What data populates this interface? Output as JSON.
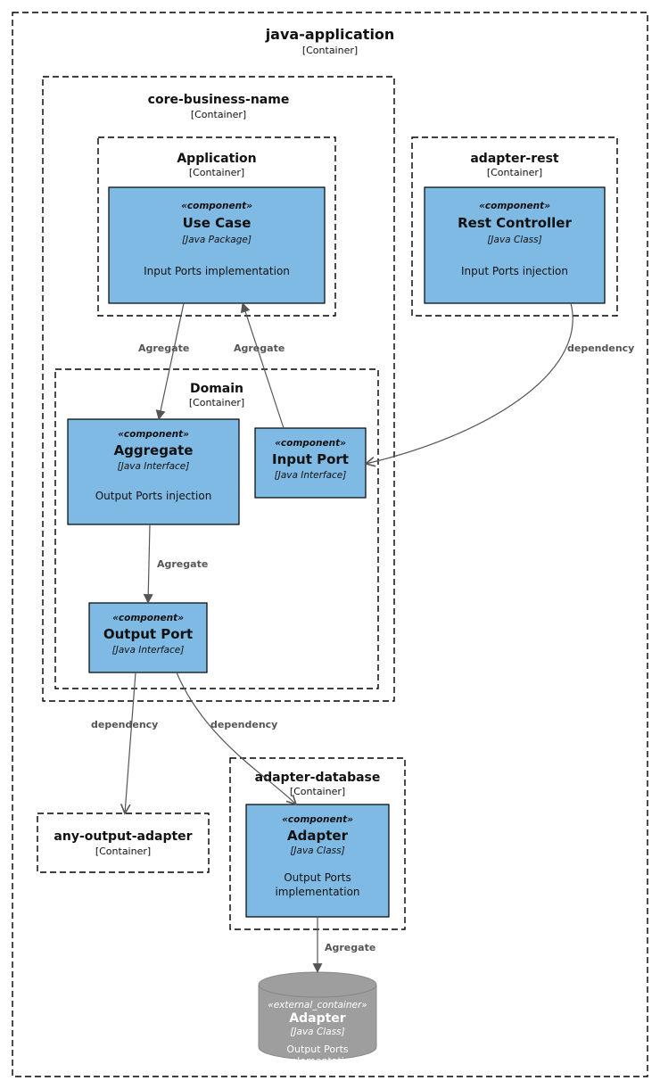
{
  "outer": {
    "title": "java-application",
    "subtype": "[Container]"
  },
  "core": {
    "title": "core-business-name",
    "subtype": "[Container]"
  },
  "application": {
    "title": "Application",
    "subtype": "[Container]"
  },
  "domain": {
    "title": "Domain",
    "subtype": "[Container]"
  },
  "adapter_rest": {
    "title": "adapter-rest",
    "subtype": "[Container]"
  },
  "adapter_db": {
    "title": "adapter-database",
    "subtype": "[Container]"
  },
  "any_output": {
    "title": "any-output-adapter",
    "subtype": "[Container]"
  },
  "usecase": {
    "stereo": "«component»",
    "name": "Use Case",
    "tech": "[Java Package]",
    "desc": "Input Ports implementation"
  },
  "restctrl": {
    "stereo": "«component»",
    "name": "Rest Controller",
    "tech": "[Java Class]",
    "desc": "Input Ports injection"
  },
  "aggregate": {
    "stereo": "«component»",
    "name": "Aggregate",
    "tech": "[Java Interface]",
    "desc": "Output Ports injection"
  },
  "inputport": {
    "stereo": "«component»",
    "name": "Input Port",
    "tech": "[Java Interface]"
  },
  "outputport": {
    "stereo": "«component»",
    "name": "Output Port",
    "tech": "[Java Interface]"
  },
  "dbadapter": {
    "stereo": "«component»",
    "name": "Adapter",
    "tech": "[Java Class]",
    "desc1": "Output Ports",
    "desc2": "implementation"
  },
  "extdb": {
    "stereo": "«external_container»",
    "name": "Adapter",
    "tech": "[Java Class]",
    "desc1": "Output Ports",
    "desc2": "implementation"
  },
  "edge": {
    "agregate": "Agregate",
    "dependency": "dependency"
  }
}
